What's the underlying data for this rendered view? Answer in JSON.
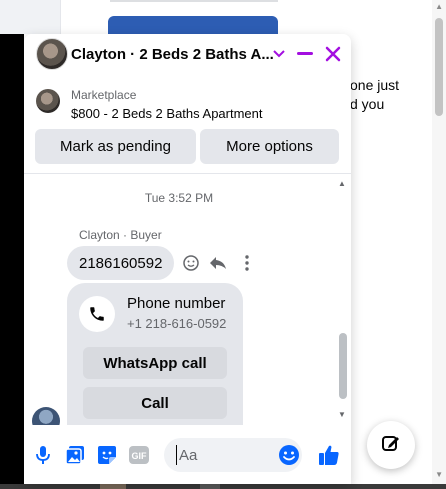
{
  "background": {
    "partial_text_line1": "one just",
    "partial_text_line2": "d you"
  },
  "chat": {
    "title": "Clayton · 2 Beds 2 Baths A...",
    "listing": {
      "label": "Marketplace",
      "title": "$800 - 2 Beds 2 Baths Apartment",
      "mark_pending_label": "Mark as pending",
      "more_options_label": "More options"
    },
    "messages": {
      "timestamp": "Tue 3:52 PM",
      "sender": "Clayton · Buyer",
      "message_text": "2186160592",
      "phone_card": {
        "title": "Phone number",
        "number": "+1 218-616-0592",
        "whatsapp_label": "WhatsApp call",
        "call_label": "Call"
      }
    },
    "composer": {
      "placeholder": "Aa",
      "value": ""
    }
  },
  "colors": {
    "accent": "#0866ff",
    "header_icons": "#a30fe0",
    "bubble": "#e4e6eb"
  },
  "icons": [
    "minimize-icon",
    "close-icon",
    "chevron-down-icon",
    "smile-icon",
    "reply-icon",
    "more-icon",
    "phone-icon",
    "microphone-icon",
    "image-icon",
    "sticker-icon",
    "gif-icon",
    "emoji-icon",
    "thumbs-up-icon",
    "compose-icon"
  ]
}
